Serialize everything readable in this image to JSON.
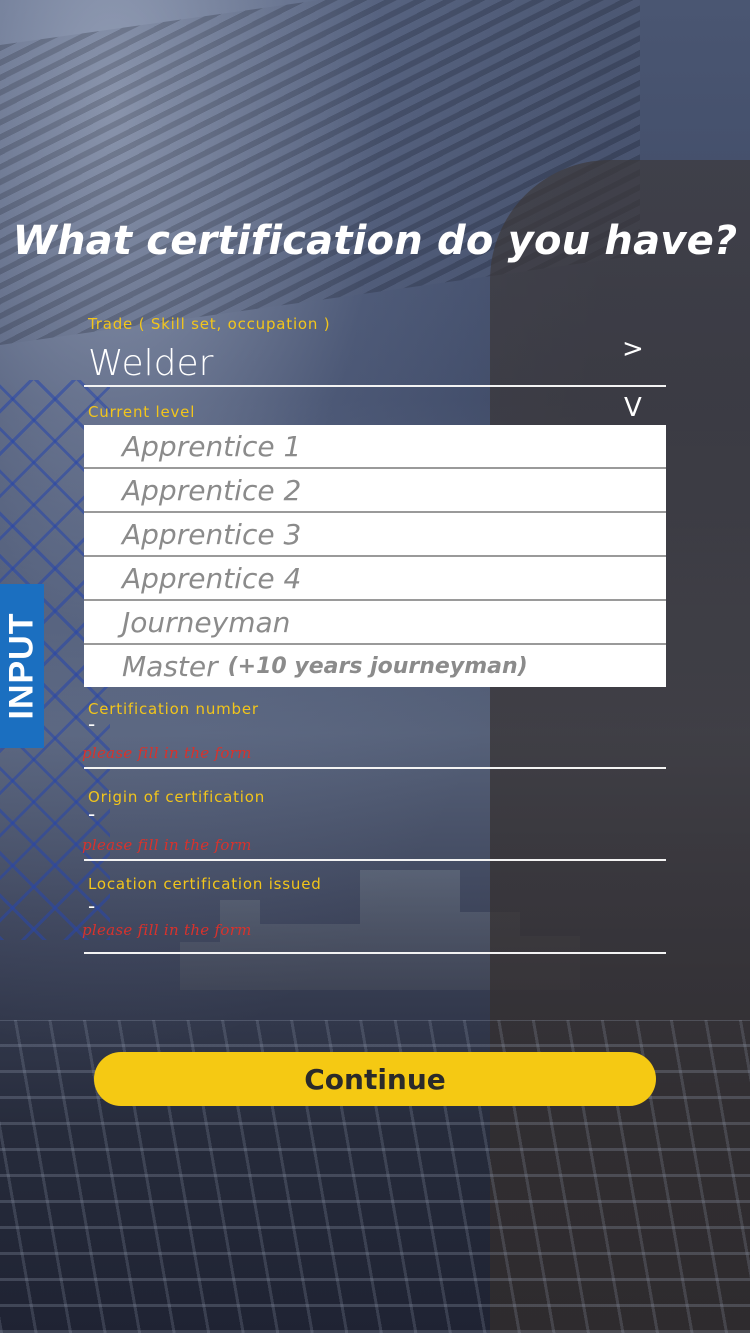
{
  "page": {
    "title": "What certification do you have?",
    "side_tab": "INPUT"
  },
  "trade": {
    "label": "Trade ( Skill set, occupation )",
    "value": "Welder",
    "chevron": ">"
  },
  "level": {
    "label": "Current level",
    "chevron": "V",
    "options": [
      {
        "label": "Apprentice 1"
      },
      {
        "label": "Apprentice 2"
      },
      {
        "label": "Apprentice 3"
      },
      {
        "label": "Apprentice 4"
      },
      {
        "label": "Journeyman"
      },
      {
        "label": "Master",
        "note": "(+10 years journeyman)"
      }
    ]
  },
  "cert_number": {
    "label": "Certification number",
    "value": "-",
    "error": "please fill in the form"
  },
  "origin": {
    "label": "Origin of certification",
    "value": "-",
    "error": "please fill in the form"
  },
  "location": {
    "label": "Location certification issued",
    "value": "-",
    "error": "please fill in the form"
  },
  "actions": {
    "continue_label": "Continue"
  },
  "colors": {
    "accent_yellow": "#f5c913",
    "label_yellow": "#f2c51b",
    "tab_blue": "#1b6fc0",
    "error_red": "#d8322c"
  }
}
